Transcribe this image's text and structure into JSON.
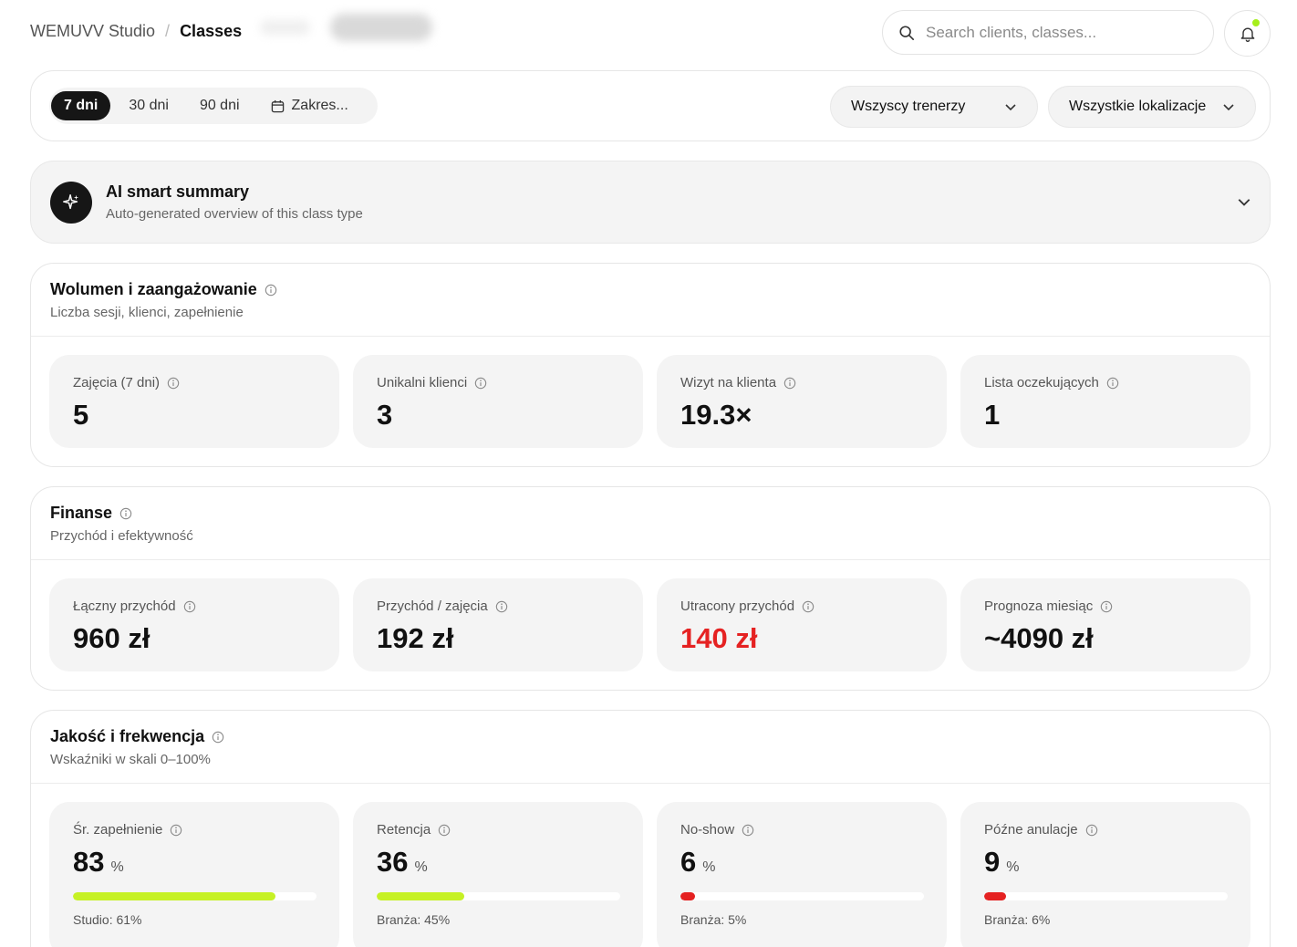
{
  "header": {
    "studio": "WEMUVV Studio",
    "separator": "/",
    "current": "Classes",
    "search_placeholder": "Search clients, classes..."
  },
  "filters": {
    "ranges": [
      "7 dni",
      "30 dni",
      "90 dni",
      "Zakres..."
    ],
    "active_range": "7 dni",
    "trainer": "Wszyscy trenerzy",
    "location": "Wszystkie lokalizacje"
  },
  "ai_summary": {
    "title": "AI smart summary",
    "subtitle": "Auto-generated overview of this class type"
  },
  "volume": {
    "title": "Wolumen i zaangażowanie",
    "subtitle": "Liczba sesji, klienci, zapełnienie",
    "cards": [
      {
        "label": "Zajęcia (7 dni)",
        "value": "5"
      },
      {
        "label": "Unikalni klienci",
        "value": "3"
      },
      {
        "label": "Wizyt na klienta",
        "value": "19.3×"
      },
      {
        "label": "Lista oczekujących",
        "value": "1"
      }
    ]
  },
  "finance": {
    "title": "Finanse",
    "subtitle": "Przychód i efektywność",
    "cards": [
      {
        "label": "Łączny przychód",
        "value": "960 zł"
      },
      {
        "label": "Przychód / zajęcia",
        "value": "192 zł"
      },
      {
        "label": "Utracony przychód",
        "value": "140 zł"
      },
      {
        "label": "Prognoza miesiąc",
        "value": "~4090 zł"
      }
    ]
  },
  "quality": {
    "title": "Jakość i frekwencja",
    "subtitle": "Wskaźniki w skali 0–100%",
    "cards": [
      {
        "label": "Śr. zapełnienie",
        "value": "83",
        "unit": "%",
        "percent": 83,
        "bar_color": "#c6f125",
        "benchmark": "Studio: 61%"
      },
      {
        "label": "Retencja",
        "value": "36",
        "unit": "%",
        "percent": 36,
        "bar_color": "#c6f125",
        "benchmark": "Branża: 45%"
      },
      {
        "label": "No-show",
        "value": "6",
        "unit": "%",
        "percent": 6,
        "bar_color": "#e52222",
        "benchmark": "Branża: 5%"
      },
      {
        "label": "Późne anulacje",
        "value": "9",
        "unit": "%",
        "percent": 9,
        "bar_color": "#e52222",
        "benchmark": "Branża: 6%"
      }
    ]
  },
  "colors": {
    "accent_green": "#c6f125",
    "alert_red": "#e52222",
    "notification_dot": "#a6ef1d"
  }
}
